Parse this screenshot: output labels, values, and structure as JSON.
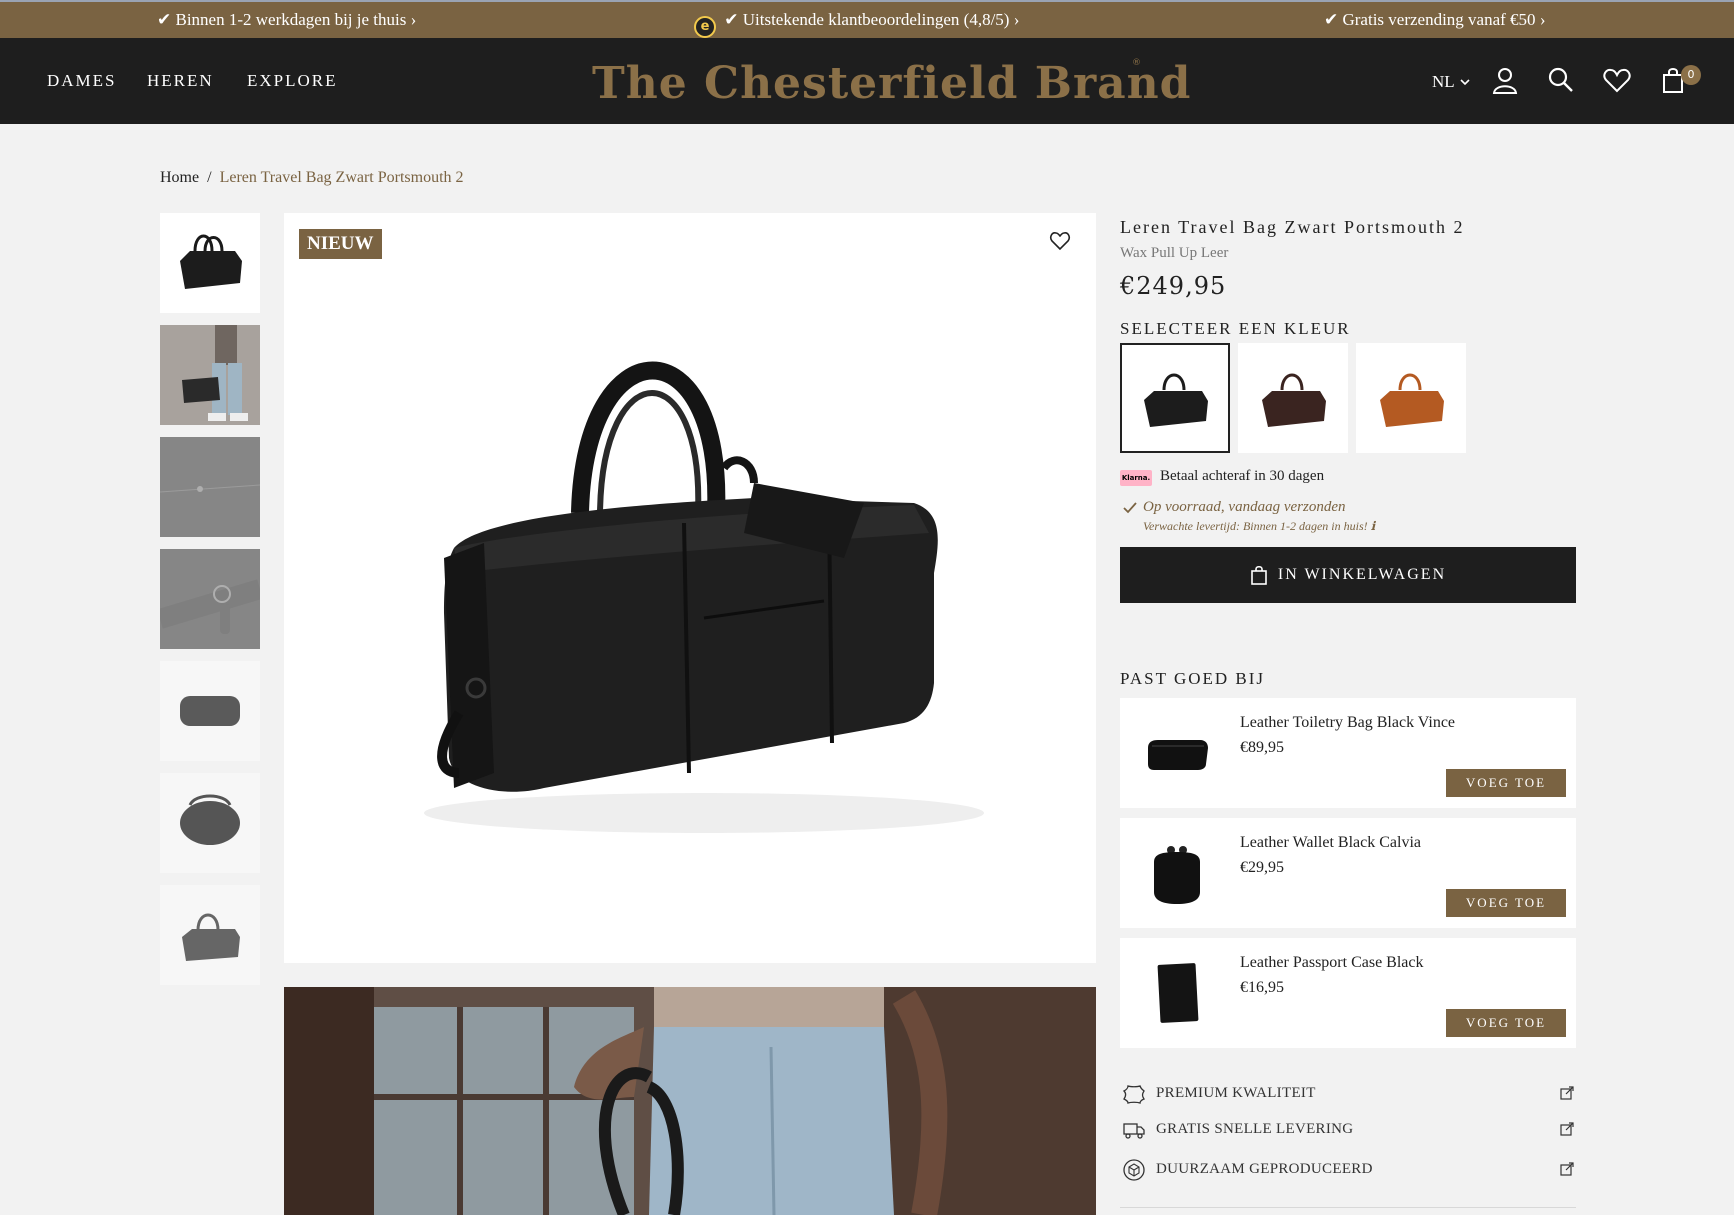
{
  "announcement": {
    "msg1": "✔ Binnen 1-2 werkdagen bij je thuis",
    "msg2": "✔ Uitstekende klantbeoordelingen (4,8/5)",
    "msg3": "✔ Gratis verzending vanaf €50",
    "trust_badge_letter": "e",
    "chevron": "›"
  },
  "header": {
    "nav": [
      "DAMES",
      "HEREN",
      "EXPLORE"
    ],
    "logo": "The Chesterfield Brand",
    "logo_mark": "®",
    "language": "NL",
    "cart_count": "0",
    "icons": [
      "chevron-down-icon",
      "account-icon",
      "search-icon",
      "heart-icon",
      "bag-icon"
    ]
  },
  "breadcrumb": {
    "home": "Home",
    "separator": "/",
    "current": "Leren Travel Bag Zwart Portsmouth 2"
  },
  "gallery": {
    "badge": "NIEUW",
    "thumbnail_count": 7
  },
  "product": {
    "title": "Leren Travel Bag Zwart Portsmouth 2",
    "subtitle": "Wax Pull Up Leer",
    "price": "€249,95",
    "color_heading": "SELECTEER EEN KLEUR",
    "colors": [
      {
        "name": "black",
        "hex": "#1c1c1c"
      },
      {
        "name": "brown",
        "hex": "#3a2420"
      },
      {
        "name": "cognac",
        "hex": "#b45a22"
      }
    ],
    "klarna_logo": "Klarna.",
    "klarna_text": "Betaal achteraf in 30 dagen",
    "stock": "Op voorraad, vandaag verzonden",
    "delivery": "Verwachte levertijd: Binnen 1-2 dagen in huis!",
    "info_glyph": "ℹ",
    "add_to_cart": "IN WINKELWAGEN"
  },
  "pairs": {
    "heading": "PAST GOED BIJ",
    "items": [
      {
        "name": "Leather Toiletry Bag Black Vince",
        "price": "€89,95",
        "button": "VOEG TOE"
      },
      {
        "name": "Leather Wallet Black Calvia",
        "price": "€29,95",
        "button": "VOEG TOE"
      },
      {
        "name": "Leather Passport Case Black",
        "price": "€16,95",
        "button": "VOEG TOE"
      }
    ]
  },
  "usps": [
    {
      "label": "PREMIUM KWALITEIT",
      "icon": "leather-hide-icon"
    },
    {
      "label": "GRATIS SNELLE LEVERING",
      "icon": "delivery-truck-icon"
    },
    {
      "label": "DUURZAAM GEPRODUCEERD",
      "icon": "eco-box-icon"
    }
  ],
  "colors": {
    "brand": "#7a6342",
    "header_bg": "#1e1e1e",
    "page_bg": "#f2f2f2"
  }
}
